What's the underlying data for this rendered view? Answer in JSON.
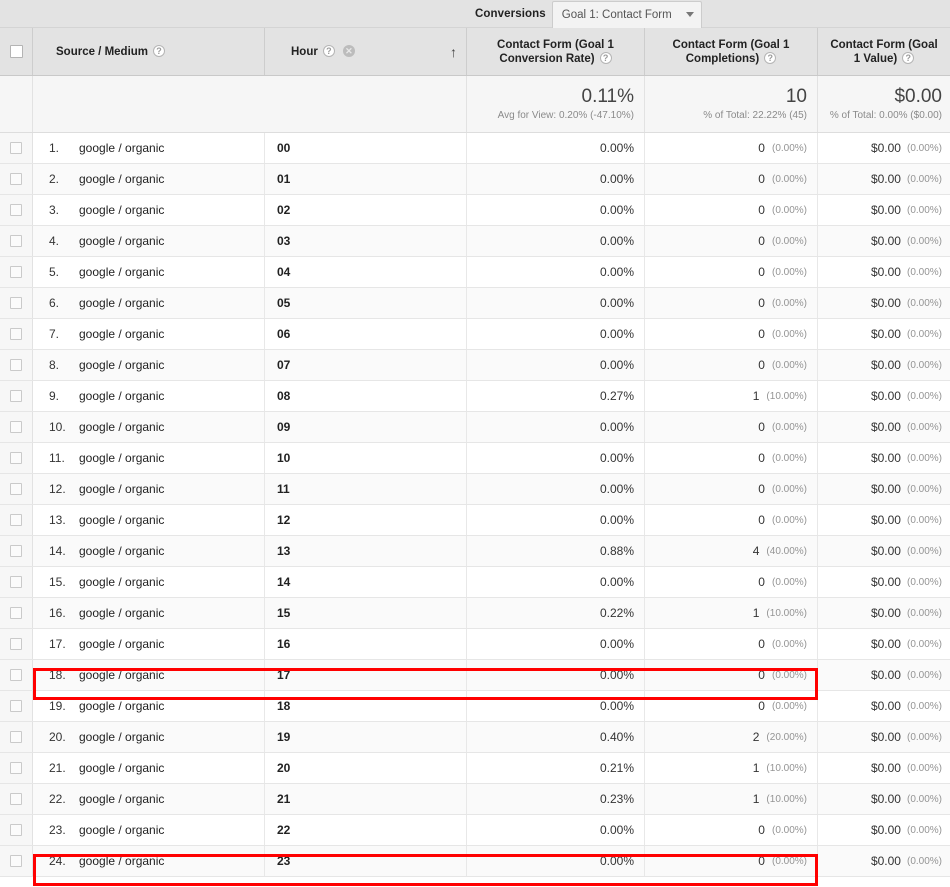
{
  "header": {
    "conversions_label": "Conversions",
    "goal_selector": {
      "value": "Goal 1: Contact Form",
      "caret": "chevron-down-icon"
    },
    "select_all_checkbox": "",
    "columns": [
      {
        "id": "source_medium",
        "label": "Source / Medium",
        "help": "?"
      },
      {
        "id": "hour",
        "label": "Hour",
        "help": "?",
        "remove": "✕",
        "sort": "↑"
      },
      {
        "id": "conv_rate",
        "label": "Contact Form (Goal 1 Conversion Rate)",
        "help": "?"
      },
      {
        "id": "completions",
        "label": "Contact Form (Goal 1 Completions)",
        "help": "?"
      },
      {
        "id": "value",
        "label": "Contact Form (Goal 1 Value)",
        "help": "?"
      }
    ]
  },
  "totals": {
    "conv_rate": {
      "value": "0.11%",
      "sub": "Avg for View: 0.20% (-47.10%)"
    },
    "completions": {
      "value": "10",
      "sub": "% of Total: 22.22% (45)"
    },
    "value": {
      "value": "$0.00",
      "sub": "% of Total: 0.00% ($0.00)"
    }
  },
  "colors": {
    "highlight": "#ff0000",
    "header_bg": "#e3e3e3",
    "totals_bg": "#f6f6f6",
    "alt_row_bg": "#fafafa"
  },
  "rows": [
    {
      "rank": "1.",
      "source": "google / organic",
      "hour": "00",
      "conv_rate": "0.00%",
      "completions": "0",
      "completions_pct": "(0.00%)",
      "value": "$0.00",
      "value_pct": "(0.00%)",
      "highlighted": false
    },
    {
      "rank": "2.",
      "source": "google / organic",
      "hour": "01",
      "conv_rate": "0.00%",
      "completions": "0",
      "completions_pct": "(0.00%)",
      "value": "$0.00",
      "value_pct": "(0.00%)",
      "highlighted": false
    },
    {
      "rank": "3.",
      "source": "google / organic",
      "hour": "02",
      "conv_rate": "0.00%",
      "completions": "0",
      "completions_pct": "(0.00%)",
      "value": "$0.00",
      "value_pct": "(0.00%)",
      "highlighted": false
    },
    {
      "rank": "4.",
      "source": "google / organic",
      "hour": "03",
      "conv_rate": "0.00%",
      "completions": "0",
      "completions_pct": "(0.00%)",
      "value": "$0.00",
      "value_pct": "(0.00%)",
      "highlighted": false
    },
    {
      "rank": "5.",
      "source": "google / organic",
      "hour": "04",
      "conv_rate": "0.00%",
      "completions": "0",
      "completions_pct": "(0.00%)",
      "value": "$0.00",
      "value_pct": "(0.00%)",
      "highlighted": false
    },
    {
      "rank": "6.",
      "source": "google / organic",
      "hour": "05",
      "conv_rate": "0.00%",
      "completions": "0",
      "completions_pct": "(0.00%)",
      "value": "$0.00",
      "value_pct": "(0.00%)",
      "highlighted": false
    },
    {
      "rank": "7.",
      "source": "google / organic",
      "hour": "06",
      "conv_rate": "0.00%",
      "completions": "0",
      "completions_pct": "(0.00%)",
      "value": "$0.00",
      "value_pct": "(0.00%)",
      "highlighted": false
    },
    {
      "rank": "8.",
      "source": "google / organic",
      "hour": "07",
      "conv_rate": "0.00%",
      "completions": "0",
      "completions_pct": "(0.00%)",
      "value": "$0.00",
      "value_pct": "(0.00%)",
      "highlighted": false
    },
    {
      "rank": "9.",
      "source": "google / organic",
      "hour": "08",
      "conv_rate": "0.27%",
      "completions": "1",
      "completions_pct": "(10.00%)",
      "value": "$0.00",
      "value_pct": "(0.00%)",
      "highlighted": false
    },
    {
      "rank": "10.",
      "source": "google / organic",
      "hour": "09",
      "conv_rate": "0.00%",
      "completions": "0",
      "completions_pct": "(0.00%)",
      "value": "$0.00",
      "value_pct": "(0.00%)",
      "highlighted": false
    },
    {
      "rank": "11.",
      "source": "google / organic",
      "hour": "10",
      "conv_rate": "0.00%",
      "completions": "0",
      "completions_pct": "(0.00%)",
      "value": "$0.00",
      "value_pct": "(0.00%)",
      "highlighted": false
    },
    {
      "rank": "12.",
      "source": "google / organic",
      "hour": "11",
      "conv_rate": "0.00%",
      "completions": "0",
      "completions_pct": "(0.00%)",
      "value": "$0.00",
      "value_pct": "(0.00%)",
      "highlighted": false
    },
    {
      "rank": "13.",
      "source": "google / organic",
      "hour": "12",
      "conv_rate": "0.00%",
      "completions": "0",
      "completions_pct": "(0.00%)",
      "value": "$0.00",
      "value_pct": "(0.00%)",
      "highlighted": false
    },
    {
      "rank": "14.",
      "source": "google / organic",
      "hour": "13",
      "conv_rate": "0.88%",
      "completions": "4",
      "completions_pct": "(40.00%)",
      "value": "$0.00",
      "value_pct": "(0.00%)",
      "highlighted": true
    },
    {
      "rank": "15.",
      "source": "google / organic",
      "hour": "14",
      "conv_rate": "0.00%",
      "completions": "0",
      "completions_pct": "(0.00%)",
      "value": "$0.00",
      "value_pct": "(0.00%)",
      "highlighted": false
    },
    {
      "rank": "16.",
      "source": "google / organic",
      "hour": "15",
      "conv_rate": "0.22%",
      "completions": "1",
      "completions_pct": "(10.00%)",
      "value": "$0.00",
      "value_pct": "(0.00%)",
      "highlighted": false
    },
    {
      "rank": "17.",
      "source": "google / organic",
      "hour": "16",
      "conv_rate": "0.00%",
      "completions": "0",
      "completions_pct": "(0.00%)",
      "value": "$0.00",
      "value_pct": "(0.00%)",
      "highlighted": false
    },
    {
      "rank": "18.",
      "source": "google / organic",
      "hour": "17",
      "conv_rate": "0.00%",
      "completions": "0",
      "completions_pct": "(0.00%)",
      "value": "$0.00",
      "value_pct": "(0.00%)",
      "highlighted": false
    },
    {
      "rank": "19.",
      "source": "google / organic",
      "hour": "18",
      "conv_rate": "0.00%",
      "completions": "0",
      "completions_pct": "(0.00%)",
      "value": "$0.00",
      "value_pct": "(0.00%)",
      "highlighted": false
    },
    {
      "rank": "20.",
      "source": "google / organic",
      "hour": "19",
      "conv_rate": "0.40%",
      "completions": "2",
      "completions_pct": "(20.00%)",
      "value": "$0.00",
      "value_pct": "(0.00%)",
      "highlighted": true
    },
    {
      "rank": "21.",
      "source": "google / organic",
      "hour": "20",
      "conv_rate": "0.21%",
      "completions": "1",
      "completions_pct": "(10.00%)",
      "value": "$0.00",
      "value_pct": "(0.00%)",
      "highlighted": false
    },
    {
      "rank": "22.",
      "source": "google / organic",
      "hour": "21",
      "conv_rate": "0.23%",
      "completions": "1",
      "completions_pct": "(10.00%)",
      "value": "$0.00",
      "value_pct": "(0.00%)",
      "highlighted": false
    },
    {
      "rank": "23.",
      "source": "google / organic",
      "hour": "22",
      "conv_rate": "0.00%",
      "completions": "0",
      "completions_pct": "(0.00%)",
      "value": "$0.00",
      "value_pct": "(0.00%)",
      "highlighted": false
    },
    {
      "rank": "24.",
      "source": "google / organic",
      "hour": "23",
      "conv_rate": "0.00%",
      "completions": "0",
      "completions_pct": "(0.00%)",
      "value": "$0.00",
      "value_pct": "(0.00%)",
      "highlighted": false
    }
  ]
}
